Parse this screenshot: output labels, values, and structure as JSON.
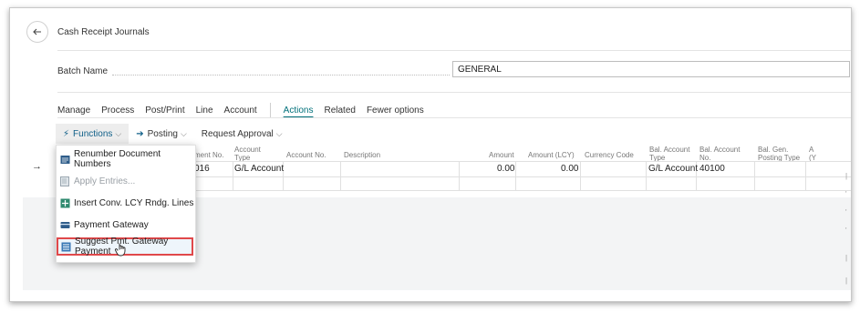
{
  "page": {
    "title": "Cash Receipt Journals"
  },
  "batch": {
    "label": "Batch Name",
    "value": "GENERAL"
  },
  "tabs": [
    {
      "label": "Manage"
    },
    {
      "label": "Process"
    },
    {
      "label": "Post/Print"
    },
    {
      "label": "Line"
    },
    {
      "label": "Account"
    },
    {
      "label": "Actions"
    },
    {
      "label": "Related"
    },
    {
      "label": "Fewer options"
    }
  ],
  "toolbar": {
    "functions": "Functions",
    "posting": "Posting",
    "request_approval": "Request Approval"
  },
  "columns": {
    "doc_no": "ment No.",
    "account_type_1": "Account",
    "account_type_2": "Type",
    "account_no": "Account No.",
    "description": "Description",
    "amount": "Amount",
    "amount_lcy": "Amount (LCY)",
    "currency_code": "Currency Code",
    "bal_type_1": "Bal. Account",
    "bal_type_2": "Type",
    "bal_no_1": "Bal. Account",
    "bal_no_2": "No.",
    "bal_gen_1": "Bal. Gen.",
    "bal_gen_2": "Posting Type",
    "extra_1": "A",
    "extra_2": "(Y"
  },
  "row": {
    "doc_no": "016",
    "account_type": "G/L Account",
    "amount": "0.00",
    "amount_lcy": "0.00",
    "bal_type": "G/L Account",
    "bal_no": "40100"
  },
  "menu": {
    "renumber": "Renumber Document Numbers",
    "apply": "Apply Entries...",
    "insert_conv": "Insert Conv. LCY Rndg. Lines",
    "payment_gateway": "Payment Gateway",
    "suggest": "Suggest Pmt. Gateway Payment"
  },
  "colors": {
    "accent": "#00707a",
    "highlight": "#e0484a"
  }
}
